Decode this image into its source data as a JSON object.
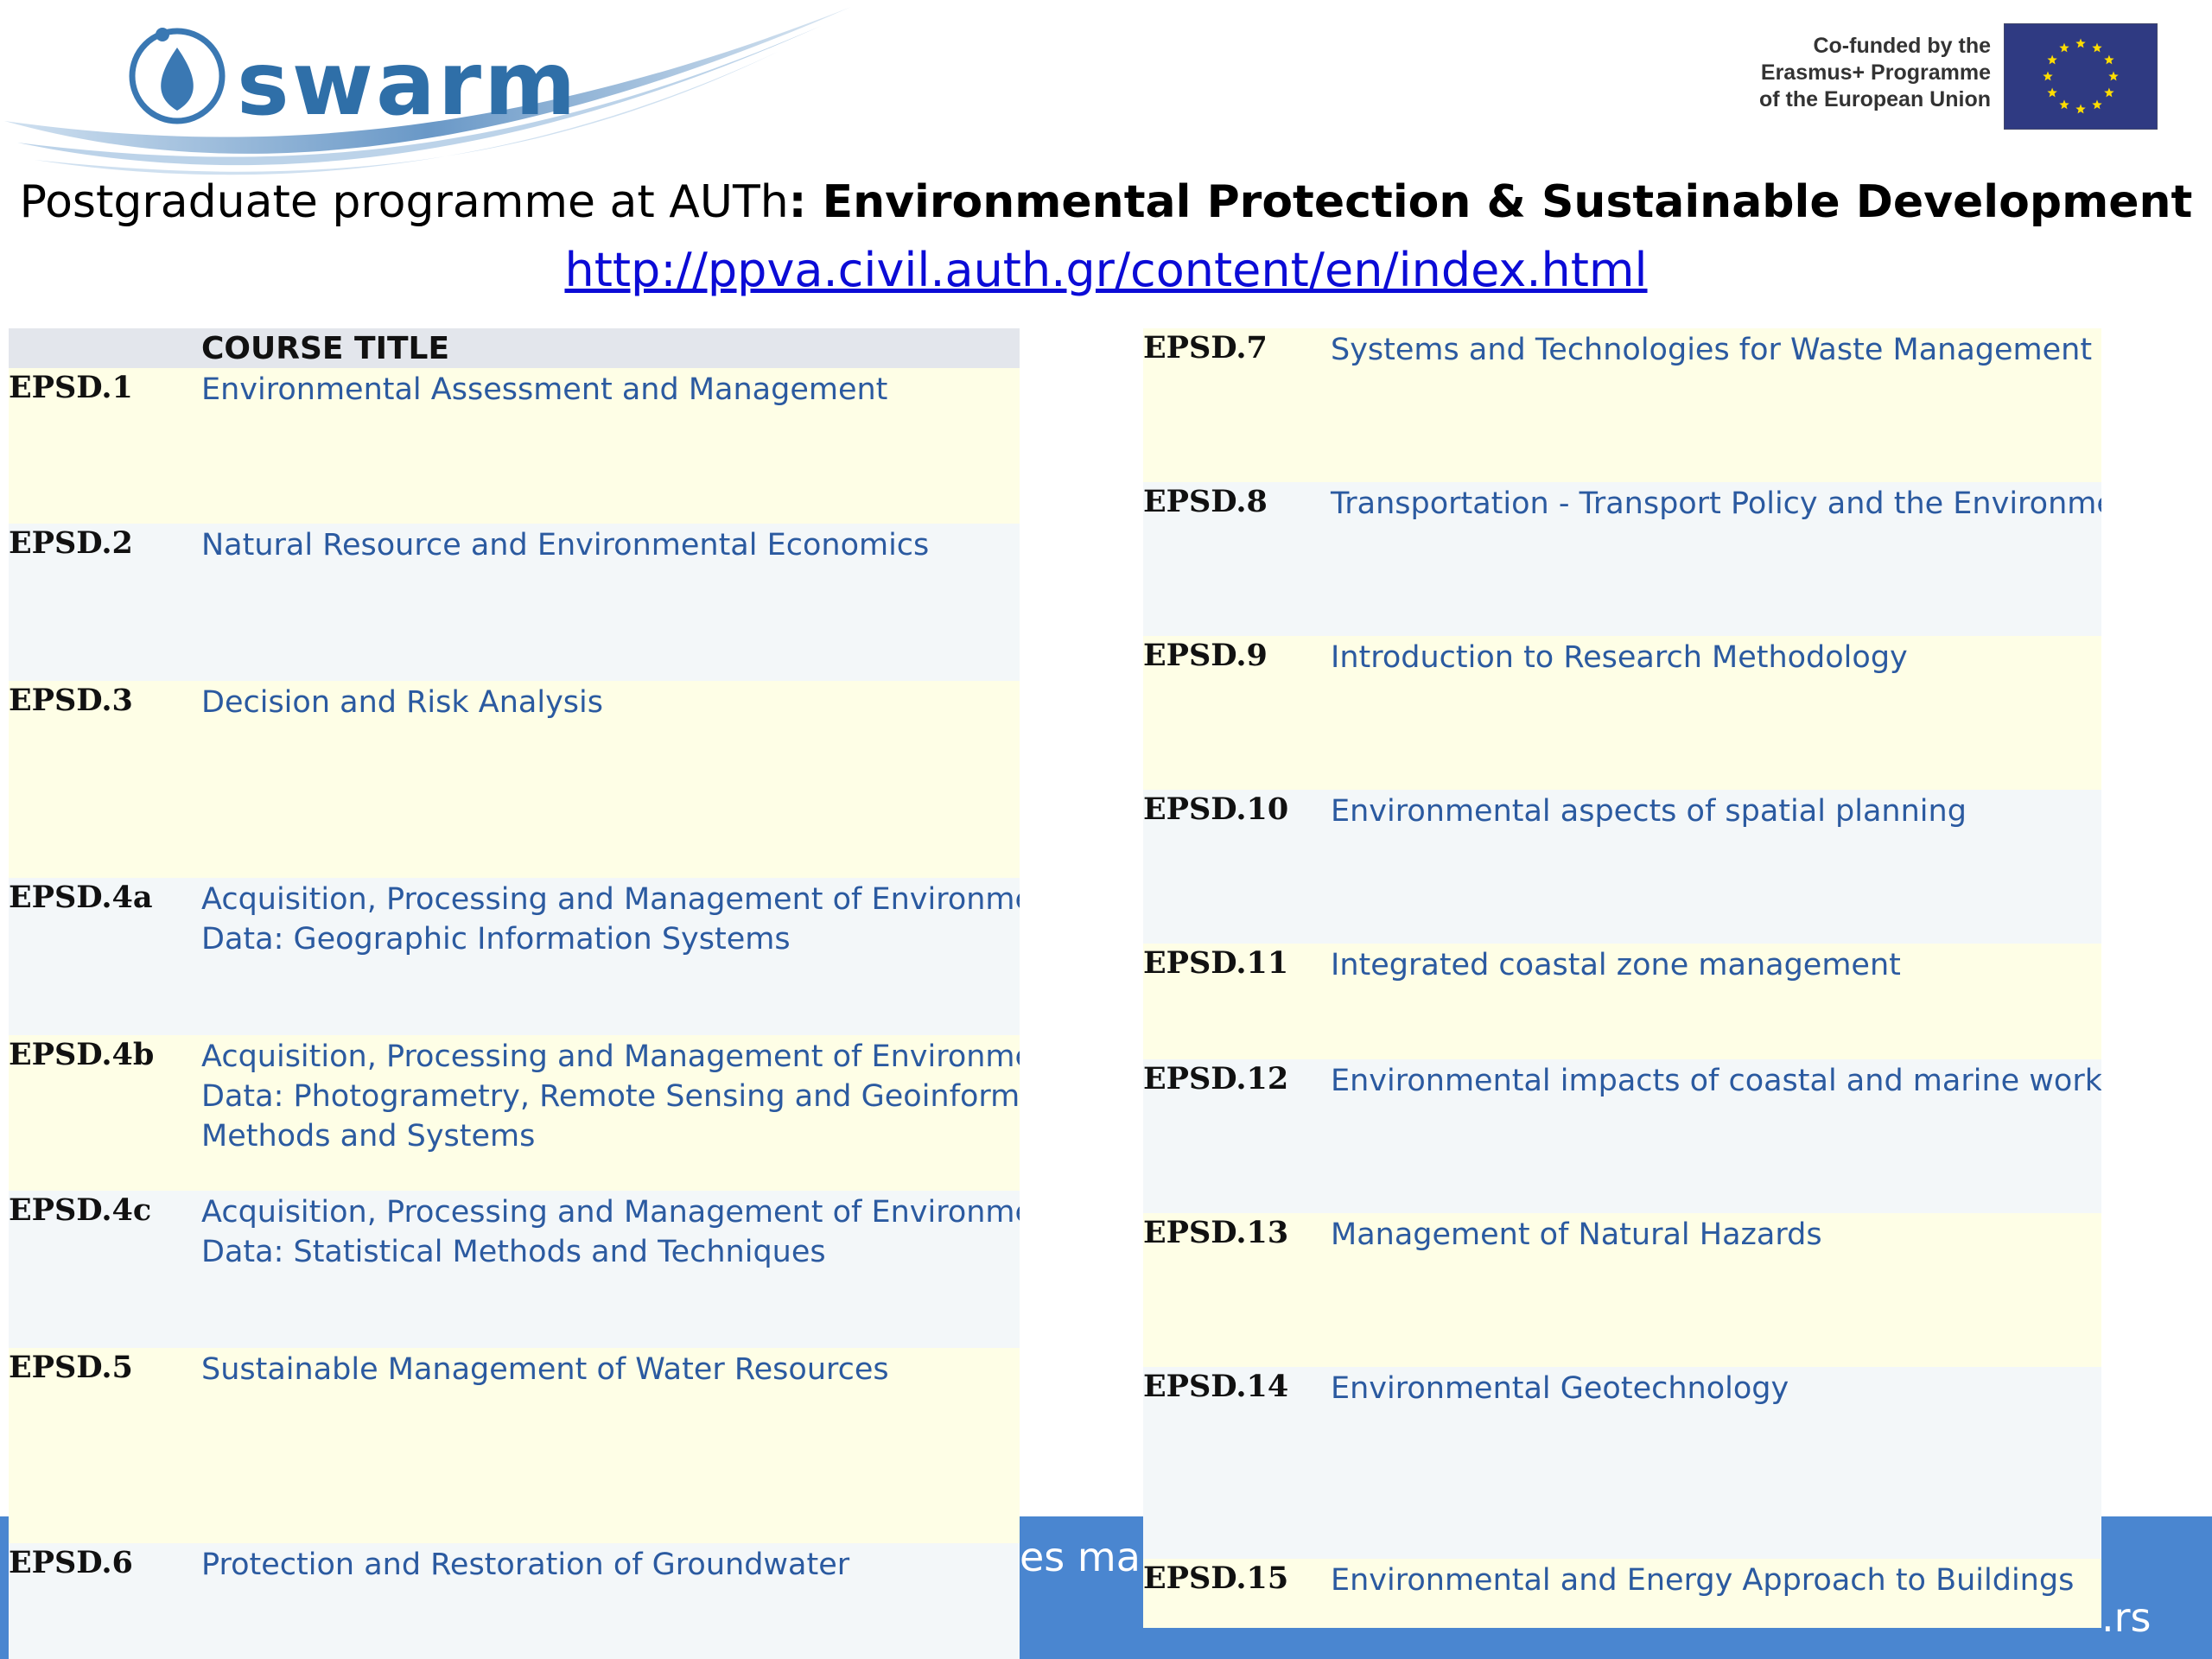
{
  "header": {
    "logo_text": "swarm",
    "eu_funding_lines": [
      "Co-funded by the",
      "Erasmus+ Programme",
      "of the European Union"
    ],
    "title_prefix": "Postgraduate programme at AUTh",
    "title_bold": ": Environmental Protection & Sustainable Development",
    "programme_url": "http://ppva.civil.auth.gr/content/en/index.html"
  },
  "footer": {
    "fragment_1": "es  ma",
    "fragment_2": ".rs",
    "band_color": "#4a86d0"
  },
  "colors": {
    "course_title": "#2b5aa0",
    "row_even": "#fefee6",
    "row_odd": "#f3f7f9",
    "header_bg": "#e3e6ec",
    "link": "#0b0bd6"
  },
  "courses_left": {
    "column_header": "COURSE TITLE",
    "rows": [
      {
        "code": "EPSD.1",
        "lines": [
          "Environmental Assessment and Management"
        ]
      },
      {
        "code": "EPSD.2",
        "lines": [
          "Natural Resource and Environmental Economics"
        ]
      },
      {
        "code": "EPSD.3",
        "lines": [
          "Decision and Risk Analysis"
        ]
      },
      {
        "code": "EPSD.4a",
        "lines": [
          "Acquisition, Processing and Management of Environmental",
          "Data: Geographic Information Systems"
        ]
      },
      {
        "code": "EPSD.4b",
        "lines": [
          "Acquisition, Processing and Management of Environmental",
          "Data: Photogrametry, Remote Sensing and Geoinformation",
          "Methods and Systems"
        ]
      },
      {
        "code": "EPSD.4c",
        "lines": [
          "Acquisition, Processing and Management of Environmental",
          "Data: Statistical Methods and Techniques"
        ]
      },
      {
        "code": "EPSD.5",
        "lines": [
          "Sustainable Management of Water Resources"
        ]
      },
      {
        "code": "EPSD.6",
        "lines": [
          "Protection and Restoration of Groundwater"
        ]
      }
    ]
  },
  "courses_right": {
    "rows": [
      {
        "code": "EPSD.7",
        "lines": [
          "Systems and Technologies for Waste Management"
        ]
      },
      {
        "code": "EPSD.8",
        "lines": [
          "Transportation - Transport Policy and the Environment"
        ]
      },
      {
        "code": "EPSD.9",
        "lines": [
          "Introduction to Research Methodology"
        ]
      },
      {
        "code": "EPSD.10",
        "lines": [
          "Environmental aspects of spatial planning"
        ]
      },
      {
        "code": "EPSD.11",
        "lines": [
          "Integrated coastal zone management"
        ]
      },
      {
        "code": "EPSD.12",
        "lines": [
          "Environmental impacts of coastal and marine works"
        ]
      },
      {
        "code": "EPSD.13",
        "lines": [
          "Management of Natural Hazards"
        ]
      },
      {
        "code": "EPSD.14",
        "lines": [
          "Environmental Geotechnology"
        ]
      },
      {
        "code": "EPSD.15",
        "lines": [
          "Environmental and Energy Approach to Buildings"
        ]
      }
    ]
  }
}
